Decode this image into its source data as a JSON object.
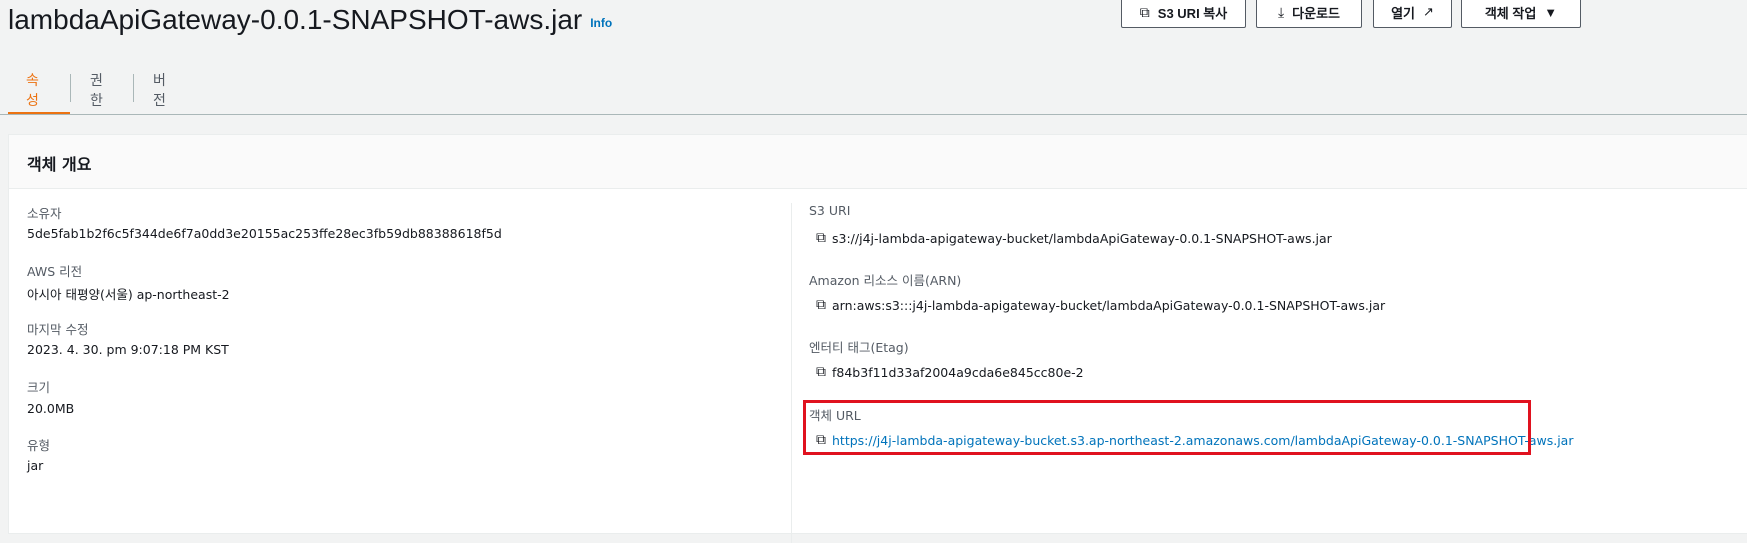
{
  "header": {
    "title": "lambdaApiGateway-0.0.1-SNAPSHOT-aws.jar",
    "info": "Info",
    "buttons": {
      "copy_s3_uri": "S3 URI 복사",
      "download": "다운로드",
      "open": "열기",
      "object_actions": "객체 작업"
    }
  },
  "tabs": [
    {
      "label": "속성",
      "active": true
    },
    {
      "label": "권한",
      "active": false
    },
    {
      "label": "버전",
      "active": false
    }
  ],
  "overview": {
    "title": "객체 개요",
    "left": {
      "owner_label": "소유자",
      "owner": "5de5fab1b2f6c5f344de6f7a0dd3e20155ac253ffe28ec3fb59db88388618f5d",
      "region_label": "AWS 리전",
      "region": "아시아 태평양(서울) ap-northeast-2",
      "modified_label": "마지막 수정",
      "modified": "2023. 4. 30. pm 9:07:18 PM KST",
      "size_label": "크기",
      "size": "20.0MB",
      "type_label": "유형",
      "type": "jar"
    },
    "right": {
      "s3_uri_label": "S3 URI",
      "s3_uri": "s3://j4j-lambda-apigateway-bucket/lambdaApiGateway-0.0.1-SNAPSHOT-aws.jar",
      "arn_label": "Amazon 리소스 이름(ARN)",
      "arn": "arn:aws:s3:::j4j-lambda-apigateway-bucket/lambdaApiGateway-0.0.1-SNAPSHOT-aws.jar",
      "etag_label": "엔터티 태그(Etag)",
      "etag": "f84b3f11d33af2004a9cda6e845cc80e-2",
      "url_label": "객체 URL",
      "url": "https://j4j-lambda-apigateway-bucket.s3.ap-northeast-2.amazonaws.com/lambdaApiGateway-0.0.1-SNAPSHOT-aws.jar"
    }
  },
  "colors": {
    "accent_tab": "#ec7211",
    "link": "#0073bb",
    "highlight_box": "#e0121f"
  },
  "icons": [
    "copy-icon",
    "download-icon",
    "external-link-icon",
    "caret-down-icon"
  ]
}
